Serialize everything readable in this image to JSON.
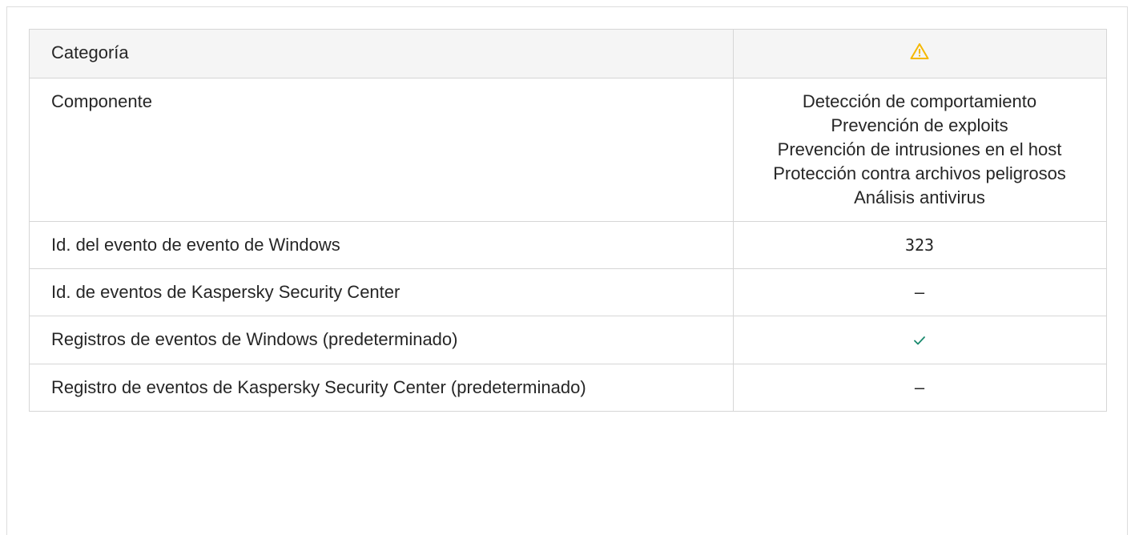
{
  "table": {
    "rows": [
      {
        "label": "Categoría",
        "value_icon": "warning-icon",
        "value_color": "#f5b800"
      },
      {
        "label": "Componente",
        "value_lines": [
          "Detección de comportamiento",
          "Prevención de exploits",
          "Prevención de intrusiones en el host",
          "Protección contra archivos peligrosos",
          "Análisis antivirus"
        ]
      },
      {
        "label": "Id. del evento de evento de Windows",
        "value": "323"
      },
      {
        "label": "Id. de eventos de Kaspersky Security Center",
        "value": "–"
      },
      {
        "label": "Registros de eventos de Windows (predeterminado)",
        "value_icon": "check-icon",
        "value_color": "#1a8a6e"
      },
      {
        "label": "Registro de eventos de Kaspersky Security Center (predeterminado)",
        "value": "–"
      }
    ]
  }
}
